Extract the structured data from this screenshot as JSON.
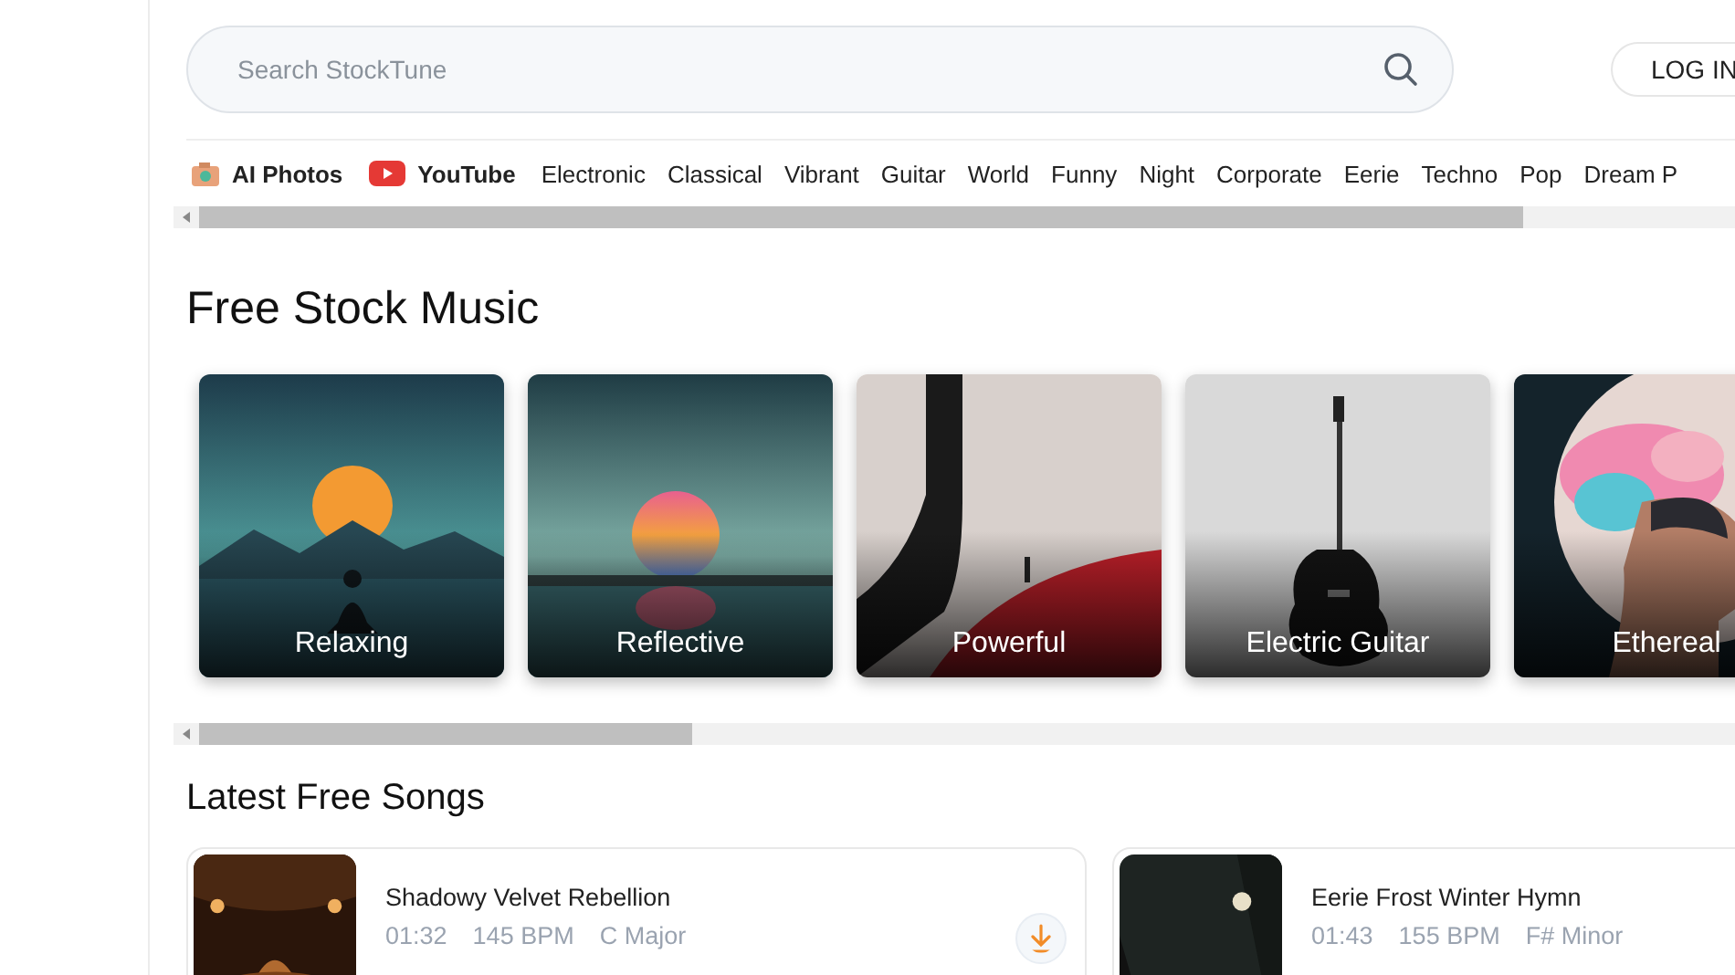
{
  "search": {
    "placeholder": "Search StockTune"
  },
  "login": {
    "label": "LOG IN"
  },
  "nav": [
    {
      "label": "AI Photos",
      "kind": "photos"
    },
    {
      "label": "YouTube",
      "kind": "video"
    },
    {
      "label": "Electronic",
      "kind": "plain"
    },
    {
      "label": "Classical",
      "kind": "plain"
    },
    {
      "label": "Vibrant",
      "kind": "plain"
    },
    {
      "label": "Guitar",
      "kind": "plain"
    },
    {
      "label": "World",
      "kind": "plain"
    },
    {
      "label": "Funny",
      "kind": "plain"
    },
    {
      "label": "Night",
      "kind": "plain"
    },
    {
      "label": "Corporate",
      "kind": "plain"
    },
    {
      "label": "Eerie",
      "kind": "plain"
    },
    {
      "label": "Techno",
      "kind": "plain"
    },
    {
      "label": "Pop",
      "kind": "plain"
    },
    {
      "label": "Dream P",
      "kind": "plain"
    }
  ],
  "section_title": "Free Stock Music",
  "categories": [
    {
      "label": "Relaxing",
      "kind": "picture"
    },
    {
      "label": "Reflective",
      "kind": "picture"
    },
    {
      "label": "Powerful",
      "kind": "picture"
    },
    {
      "label": "Electric Guitar",
      "kind": "picture"
    },
    {
      "label": "Ethereal",
      "kind": "picture"
    }
  ],
  "songs_title": "Latest Free Songs",
  "songs": [
    {
      "title": "Shadowy Velvet Rebellion",
      "duration": "01:32",
      "bpm": "145 BPM",
      "key": "C Major"
    },
    {
      "title": "Eerie Frost Winter Hymn",
      "duration": "01:43",
      "bpm": "155 BPM",
      "key": "F# Minor"
    }
  ]
}
